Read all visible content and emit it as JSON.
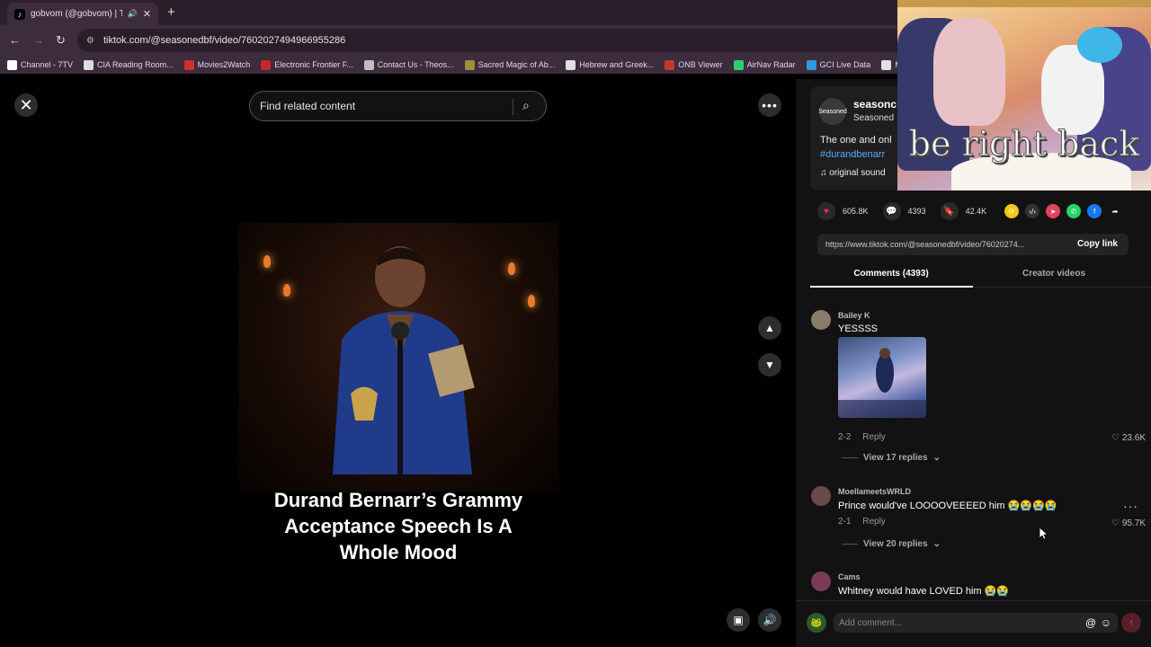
{
  "browser": {
    "tab_title": "gobvom (@gobvom) | TikTo",
    "new_tab": "+",
    "url": "tiktok.com/@seasonedbf/video/7602027494966955286",
    "bookmarks": [
      {
        "label": "Channel - 7TV",
        "color": "#ffffff"
      },
      {
        "label": "CIA Reading Room...",
        "color": "#dddddd"
      },
      {
        "label": "Movies2Watch",
        "color": "#d32f2f"
      },
      {
        "label": "Electronic Frontier F...",
        "color": "#c62828"
      },
      {
        "label": "Contact Us - Theos...",
        "color": "#bdbdbd"
      },
      {
        "label": "Sacred Magic of Ab...",
        "color": "#9e8f3a"
      },
      {
        "label": "Hebrew and Greek...",
        "color": "#e0e0e0"
      },
      {
        "label": "ONB Viewer",
        "color": "#c0392b"
      },
      {
        "label": "AirNav Radar",
        "color": "#2ecc71"
      },
      {
        "label": "GCI Live Data",
        "color": "#3498db"
      },
      {
        "label": "Mi",
        "color": "#e0e0e0"
      }
    ]
  },
  "player": {
    "search_placeholder": "Find related content",
    "caption_line1": "Durand Bernarr’s Grammy",
    "caption_line2": "Acceptance Speech Is A",
    "caption_line3": "Whole Mood"
  },
  "author": {
    "avatar_text": "Seasoned",
    "name": "seasonc",
    "subname": "Seasoned",
    "description": "The one and onl",
    "hashtag": "#durandbenarr",
    "music": "original sound"
  },
  "actions": {
    "likes": "605.8K",
    "comments": "4393",
    "saves": "42.4K",
    "share_icons": [
      {
        "name": "repost-icon",
        "color": "#f5c518",
        "glyph": "⟳"
      },
      {
        "name": "embed-icon",
        "color": "#333333",
        "glyph": "‹/›"
      },
      {
        "name": "send-icon",
        "color": "#e4405f",
        "glyph": "➤"
      },
      {
        "name": "whatsapp-icon",
        "color": "#25d366",
        "glyph": "✆"
      },
      {
        "name": "facebook-icon",
        "color": "#1877f2",
        "glyph": "f"
      },
      {
        "name": "share-arrow-icon",
        "color": "transparent",
        "glyph": "➦"
      }
    ]
  },
  "link": {
    "url": "https://www.tiktok.com/@seasonedbf/video/76020274...",
    "copy_label": "Copy link"
  },
  "tabs": {
    "comments": "Comments (4393)",
    "creator": "Creator videos"
  },
  "comments": [
    {
      "user": "Bailey K",
      "text": "YESSSS",
      "date": "2-2",
      "reply": "Reply",
      "likes": "23.6K",
      "view_replies": "View 17 replies",
      "avatar_color": "#8a7a6a"
    },
    {
      "user": "MoellameetsWRLD",
      "text": "Prince would've LOOOOVEEEED him 😭😭😭😭",
      "date": "2-1",
      "reply": "Reply",
      "likes": "95.7K",
      "view_replies": "View 20 replies",
      "avatar_color": "#6a4a4a"
    },
    {
      "user": "Cams",
      "text": "Whitney would have LOVED him 😭😭",
      "avatar_color": "#7a3a5a"
    }
  ],
  "add_comment": {
    "placeholder": "Add comment..."
  },
  "pip": {
    "overlay_text": "be right back"
  }
}
